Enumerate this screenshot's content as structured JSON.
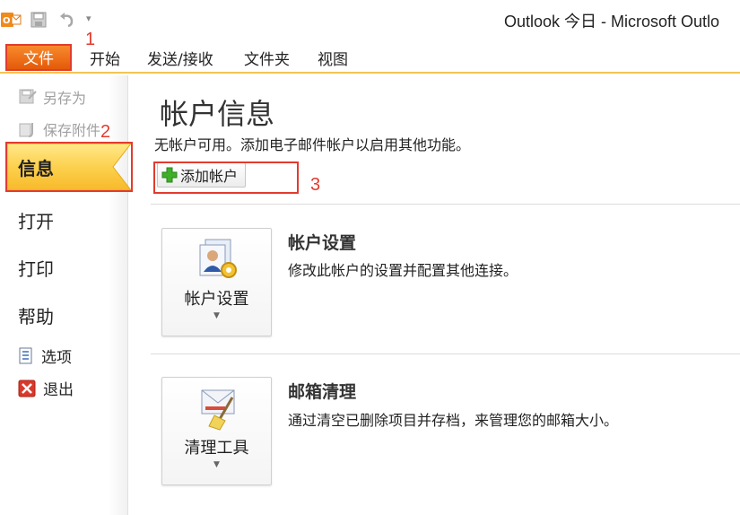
{
  "window": {
    "title": "Outlook 今日 - Microsoft Outlo"
  },
  "quick_access": {
    "dropdown_glyph": "▾",
    "icons": [
      "outlook-logo-icon",
      "save-icon",
      "undo-icon"
    ]
  },
  "ribbon": {
    "tabs": [
      {
        "label": "文件"
      },
      {
        "label": "开始"
      },
      {
        "label": "发送/接收"
      },
      {
        "label": "文件夹"
      },
      {
        "label": "视图"
      }
    ]
  },
  "nav": {
    "save_as": "另存为",
    "save_attachments": "保存附件",
    "info": "信息",
    "open": "打开",
    "print": "打印",
    "help": "帮助",
    "options": "选项",
    "exit": "退出"
  },
  "main": {
    "title": "帐户信息",
    "description": "无帐户可用。添加电子邮件帐户以启用其他功能。",
    "add_account": "添加帐户",
    "account_settings": {
      "button_label": "帐户设置",
      "title": "帐户设置",
      "description": "修改此帐户的设置并配置其他连接。"
    },
    "mailbox_cleanup": {
      "button_label": "清理工具",
      "title": "邮箱清理",
      "description": "通过清空已删除项目并存档，来管理您的邮箱大小。"
    }
  },
  "annotations": {
    "step1": "1",
    "step2": "2",
    "step3": "3"
  },
  "colors": {
    "accent_orange": "#f0781a",
    "annotation_red": "#e23b2e",
    "info_highlight": "#fcd75a"
  }
}
